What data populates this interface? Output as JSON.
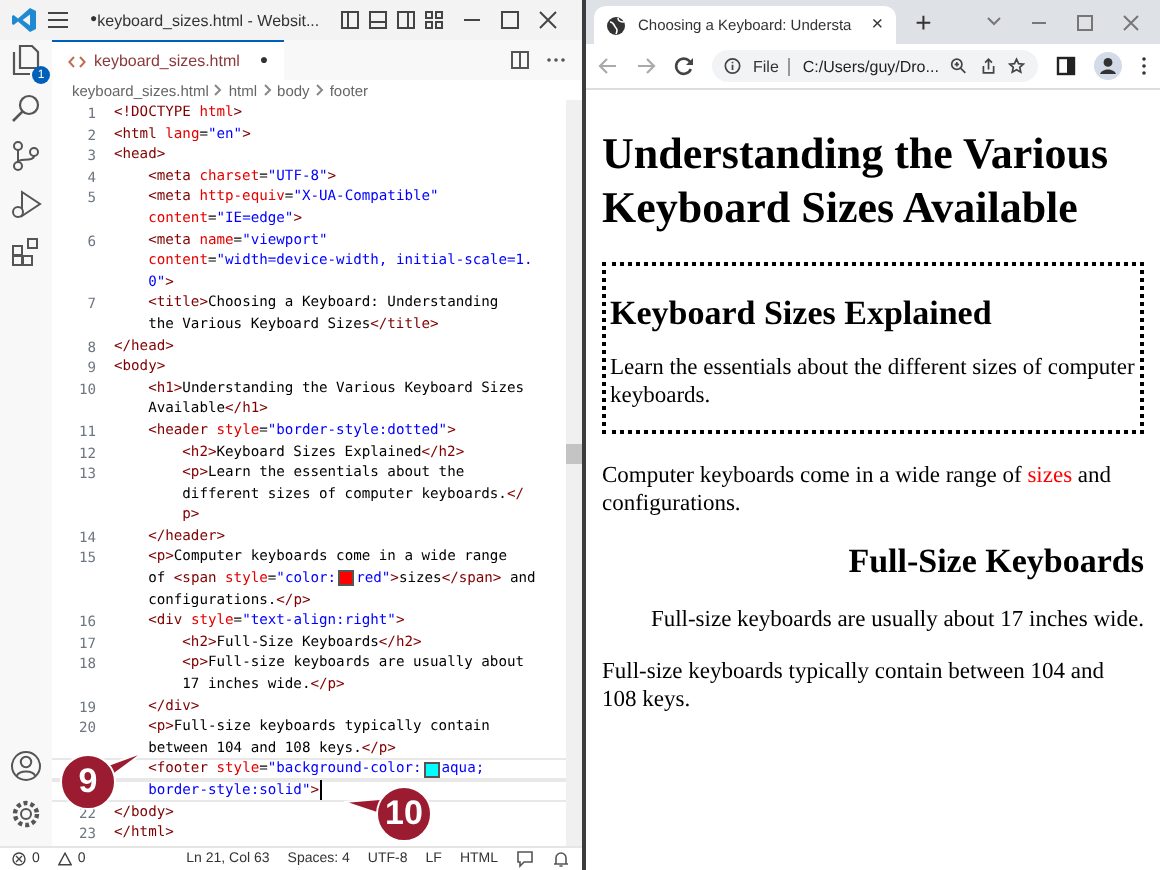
{
  "editor": {
    "title": "keyboard_sizes.html - Websit...",
    "title_mark": "●",
    "activity_badge": "1",
    "tab": {
      "label": "keyboard_sizes.html",
      "dirty_mark": "●"
    },
    "breadcrumbs": [
      "keyboard_sizes.html",
      "html",
      "body",
      "footer"
    ],
    "lines": [
      {
        "number": "1",
        "current": false,
        "rows": [
          {
            "tokens": [
              {
                "kind": "tag",
                "text": "<!DOCTYPE"
              },
              {
                "kind": "attr",
                "text": " html"
              },
              {
                "kind": "tag",
                "text": ">"
              }
            ]
          }
        ]
      },
      {
        "number": "2",
        "current": false,
        "rows": [
          {
            "tokens": [
              {
                "kind": "tag",
                "text": "<html"
              },
              {
                "kind": "attr",
                "text": " lang"
              },
              {
                "kind": "text",
                "text": "="
              },
              {
                "kind": "str",
                "text": "\"en\""
              },
              {
                "kind": "tag",
                "text": ">"
              }
            ]
          }
        ]
      },
      {
        "number": "3",
        "current": false,
        "rows": [
          {
            "tokens": [
              {
                "kind": "tag",
                "text": "<head>"
              }
            ]
          }
        ]
      },
      {
        "number": "4",
        "current": false,
        "rows": [
          {
            "tokens": [
              {
                "kind": "tag",
                "text": "    <meta"
              },
              {
                "kind": "attr",
                "text": " charset"
              },
              {
                "kind": "text",
                "text": "="
              },
              {
                "kind": "str",
                "text": "\"UTF-8\""
              },
              {
                "kind": "tag",
                "text": ">"
              }
            ]
          }
        ]
      },
      {
        "number": "5",
        "current": false,
        "rows": [
          {
            "tokens": [
              {
                "kind": "tag",
                "text": "    <meta"
              },
              {
                "kind": "attr",
                "text": " http-equiv"
              },
              {
                "kind": "text",
                "text": "="
              },
              {
                "kind": "str",
                "text": "\"X-UA-Compatible\""
              }
            ]
          },
          {
            "tokens": [
              {
                "kind": "attr",
                "text": "    content"
              },
              {
                "kind": "text",
                "text": "="
              },
              {
                "kind": "str",
                "text": "\"IE=edge\""
              },
              {
                "kind": "tag",
                "text": ">"
              }
            ]
          }
        ]
      },
      {
        "number": "6",
        "current": false,
        "rows": [
          {
            "tokens": [
              {
                "kind": "tag",
                "text": "    <meta"
              },
              {
                "kind": "attr",
                "text": " name"
              },
              {
                "kind": "text",
                "text": "="
              },
              {
                "kind": "str",
                "text": "\"viewport\""
              }
            ]
          },
          {
            "tokens": [
              {
                "kind": "attr",
                "text": "    content"
              },
              {
                "kind": "text",
                "text": "="
              },
              {
                "kind": "str",
                "text": "\"width=device-width, initial-scale=1."
              }
            ]
          },
          {
            "tokens": [
              {
                "kind": "str",
                "text": "    0\""
              },
              {
                "kind": "tag",
                "text": ">"
              }
            ]
          }
        ]
      },
      {
        "number": "7",
        "current": false,
        "rows": [
          {
            "tokens": [
              {
                "kind": "tag",
                "text": "    <title>"
              },
              {
                "kind": "text",
                "text": "Choosing a Keyboard: Understanding"
              }
            ]
          },
          {
            "tokens": [
              {
                "kind": "text",
                "text": "    the Various Keyboard Sizes"
              },
              {
                "kind": "tag",
                "text": "</title>"
              }
            ]
          }
        ]
      },
      {
        "number": "8",
        "current": false,
        "rows": [
          {
            "tokens": [
              {
                "kind": "tag",
                "text": "</head>"
              }
            ]
          }
        ]
      },
      {
        "number": "9",
        "current": false,
        "rows": [
          {
            "tokens": [
              {
                "kind": "tag",
                "text": "<body>"
              }
            ]
          }
        ]
      },
      {
        "number": "10",
        "current": false,
        "rows": [
          {
            "tokens": [
              {
                "kind": "tag",
                "text": "    <h1>"
              },
              {
                "kind": "text",
                "text": "Understanding the Various Keyboard Sizes"
              }
            ]
          },
          {
            "tokens": [
              {
                "kind": "text",
                "text": "    Available"
              },
              {
                "kind": "tag",
                "text": "</h1>"
              }
            ]
          }
        ]
      },
      {
        "number": "11",
        "current": false,
        "rows": [
          {
            "tokens": [
              {
                "kind": "tag",
                "text": "    <header"
              },
              {
                "kind": "attr",
                "text": " style"
              },
              {
                "kind": "text",
                "text": "="
              },
              {
                "kind": "str",
                "text": "\"border-style:dotted\""
              },
              {
                "kind": "tag",
                "text": ">"
              }
            ]
          }
        ]
      },
      {
        "number": "12",
        "current": false,
        "rows": [
          {
            "tokens": [
              {
                "kind": "tag",
                "text": "        <h2>"
              },
              {
                "kind": "text",
                "text": "Keyboard Sizes Explained"
              },
              {
                "kind": "tag",
                "text": "</h2>"
              }
            ]
          }
        ]
      },
      {
        "number": "13",
        "current": false,
        "rows": [
          {
            "tokens": [
              {
                "kind": "tag",
                "text": "        <p>"
              },
              {
                "kind": "text",
                "text": "Learn the essentials about the"
              }
            ]
          },
          {
            "tokens": [
              {
                "kind": "text",
                "text": "        different sizes of computer keyboards."
              },
              {
                "kind": "tag",
                "text": "</"
              }
            ]
          },
          {
            "tokens": [
              {
                "kind": "tag",
                "text": "        p>"
              }
            ]
          }
        ]
      },
      {
        "number": "14",
        "current": false,
        "rows": [
          {
            "tokens": [
              {
                "kind": "tag",
                "text": "    </header>"
              }
            ]
          }
        ]
      },
      {
        "number": "15",
        "current": false,
        "rows": [
          {
            "tokens": [
              {
                "kind": "tag",
                "text": "    <p>"
              },
              {
                "kind": "text",
                "text": "Computer keyboards come in a wide range"
              }
            ]
          },
          {
            "tokens": [
              {
                "kind": "text",
                "text": "    of "
              },
              {
                "kind": "tag",
                "text": "<span"
              },
              {
                "kind": "attr",
                "text": " style"
              },
              {
                "kind": "text",
                "text": "="
              },
              {
                "kind": "str",
                "text": "\"color:"
              },
              {
                "kind": "swatch",
                "color": "#ff0000"
              },
              {
                "kind": "str",
                "text": "red\""
              },
              {
                "kind": "tag",
                "text": ">"
              },
              {
                "kind": "text",
                "text": "sizes"
              },
              {
                "kind": "tag",
                "text": "</span>"
              },
              {
                "kind": "text",
                "text": " and"
              }
            ]
          },
          {
            "tokens": [
              {
                "kind": "text",
                "text": "    configurations."
              },
              {
                "kind": "tag",
                "text": "</p>"
              }
            ]
          }
        ]
      },
      {
        "number": "16",
        "current": false,
        "rows": [
          {
            "tokens": [
              {
                "kind": "tag",
                "text": "    <div"
              },
              {
                "kind": "attr",
                "text": " style"
              },
              {
                "kind": "text",
                "text": "="
              },
              {
                "kind": "str",
                "text": "\"text-align:right\""
              },
              {
                "kind": "tag",
                "text": ">"
              }
            ]
          }
        ]
      },
      {
        "number": "17",
        "current": false,
        "rows": [
          {
            "tokens": [
              {
                "kind": "tag",
                "text": "        <h2>"
              },
              {
                "kind": "text",
                "text": "Full-Size Keyboards"
              },
              {
                "kind": "tag",
                "text": "</h2>"
              }
            ]
          }
        ]
      },
      {
        "number": "18",
        "current": false,
        "rows": [
          {
            "tokens": [
              {
                "kind": "tag",
                "text": "        <p>"
              },
              {
                "kind": "text",
                "text": "Full-size keyboards are usually about"
              }
            ]
          },
          {
            "tokens": [
              {
                "kind": "text",
                "text": "        17 inches wide."
              },
              {
                "kind": "tag",
                "text": "</p>"
              }
            ]
          }
        ]
      },
      {
        "number": "19",
        "current": false,
        "rows": [
          {
            "tokens": [
              {
                "kind": "tag",
                "text": "    </div>"
              }
            ]
          }
        ]
      },
      {
        "number": "20",
        "current": false,
        "rows": [
          {
            "tokens": [
              {
                "kind": "tag",
                "text": "    <p>"
              },
              {
                "kind": "text",
                "text": "Full-size keyboards typically contain"
              }
            ]
          },
          {
            "tokens": [
              {
                "kind": "text",
                "text": "    between 104 and 108 keys."
              },
              {
                "kind": "tag",
                "text": "</p>"
              }
            ]
          }
        ]
      },
      {
        "current": true,
        "rows": [
          {
            "tokens": [
              {
                "kind": "tag",
                "text": "    <footer"
              },
              {
                "kind": "attr",
                "text": " style"
              },
              {
                "kind": "text",
                "text": "="
              },
              {
                "kind": "str",
                "text": "\"background-color:"
              },
              {
                "kind": "swatch",
                "color": "#00ffff"
              },
              {
                "kind": "str",
                "text": "aqua;"
              }
            ]
          },
          {
            "tokens": [
              {
                "kind": "str",
                "text": "    border-style:solid\""
              },
              {
                "kind": "tag",
                "text": ">"
              }
            ]
          }
        ]
      },
      {
        "number": "22",
        "current": false,
        "rows": [
          {
            "tokens": [
              {
                "kind": "tag",
                "text": "</body>"
              }
            ]
          }
        ]
      },
      {
        "number": "23",
        "current": false,
        "rows": [
          {
            "tokens": [
              {
                "kind": "tag",
                "text": "</html>"
              }
            ]
          }
        ]
      }
    ],
    "status": {
      "errors": "0",
      "warnings": "0",
      "position": "Ln 21, Col 63",
      "indent": "Spaces: 4",
      "encoding": "UTF-8",
      "eol": "LF",
      "language": "HTML"
    }
  },
  "browser": {
    "tab_title": "Choosing a Keyboard: Understa",
    "tab_close": "×",
    "new_tab": "+",
    "scheme": "File",
    "address": "C:/Users/guy/Dro...",
    "page": {
      "h1": "Understanding the Various Keyboard Sizes Available",
      "header": {
        "h2": "Keyboard Sizes Explained",
        "p": "Learn the essentials about the different sizes of computer keyboards."
      },
      "intro": [
        {
          "kind": "plain",
          "text": "Computer keyboards come in a wide range of "
        },
        {
          "kind": "colored",
          "text": "sizes",
          "color": "#ff0000"
        },
        {
          "kind": "plain",
          "text": " and configurations."
        }
      ],
      "right_block": {
        "h2": "Full-Size Keyboards",
        "p": "Full-size keyboards are usually about 17 inches wide."
      },
      "closing": "Full-size keyboards typically contain between 104 and 108 keys."
    }
  },
  "callouts": [
    {
      "label": "9",
      "kind": "points_right"
    },
    {
      "label": "10",
      "kind": "points_left"
    }
  ]
}
